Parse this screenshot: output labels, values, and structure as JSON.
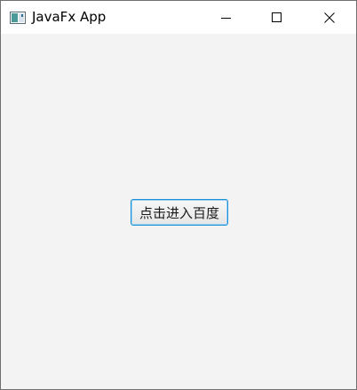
{
  "window": {
    "title": "JavaFx App",
    "app_icon": "javafx-window-icon"
  },
  "caption_buttons": {
    "minimize_icon": "minimize-icon",
    "maximize_icon": "maximize-icon",
    "close_icon": "close-icon"
  },
  "main": {
    "button_label": "点击进入百度"
  },
  "colors": {
    "title_bar": "#ffffff",
    "content_bg": "#f3f3f3",
    "button_focus_border": "#1e90d7"
  }
}
